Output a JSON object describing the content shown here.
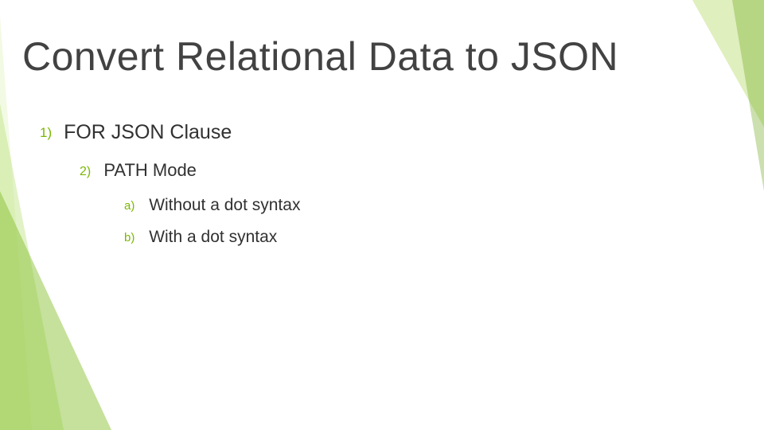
{
  "title": "Convert Relational Data to JSON",
  "bullets": {
    "l1": {
      "marker": "1)",
      "text": "FOR JSON Clause"
    },
    "l2": {
      "marker": "2)",
      "text": "PATH Mode"
    },
    "l3": [
      {
        "marker": "a)",
        "text": "Without a dot syntax"
      },
      {
        "marker": "b)",
        "text": "With a dot syntax"
      }
    ]
  }
}
